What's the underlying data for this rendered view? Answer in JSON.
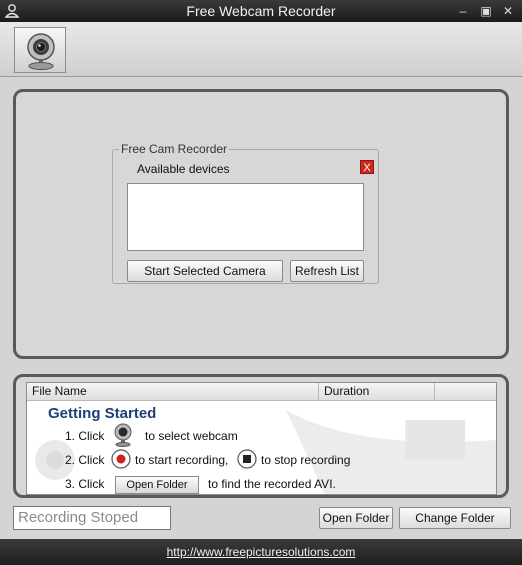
{
  "window": {
    "title": "Free Webcam Recorder",
    "minimize_glyph": "–",
    "maximize_glyph": "▣",
    "close_glyph": "✕"
  },
  "toolbar": {
    "webcam_button_icon": "webcam-icon"
  },
  "device_panel": {
    "group_title": "Free Cam Recorder",
    "close_label": "X",
    "available_label": "Available devices",
    "devices": [],
    "start_button": "Start Selected Camera",
    "refresh_button": "Refresh List"
  },
  "file_list": {
    "columns": [
      "File Name",
      "Duration"
    ],
    "rows": []
  },
  "getting_started": {
    "title": "Getting  Started",
    "step1_prefix": "1. Click",
    "step1_suffix": "to select webcam",
    "step2_prefix": "2. Click",
    "step2_middle": "to start recording,",
    "step2_suffix": "to stop recording",
    "step3_prefix": "3. Click",
    "step3_button": "Open Folder",
    "step3_suffix": "to find the recorded AVI."
  },
  "bottom_bar": {
    "status_text": "Recording Stoped",
    "open_folder_button": "Open Folder",
    "change_folder_button": "Change Folder"
  },
  "footer": {
    "link_text": "http://www.freepicturesolutions.com"
  },
  "colors": {
    "title_bar": "#1b1b1b",
    "getting_started_title": "#1f3f7a",
    "record_icon": "#d0201a"
  }
}
